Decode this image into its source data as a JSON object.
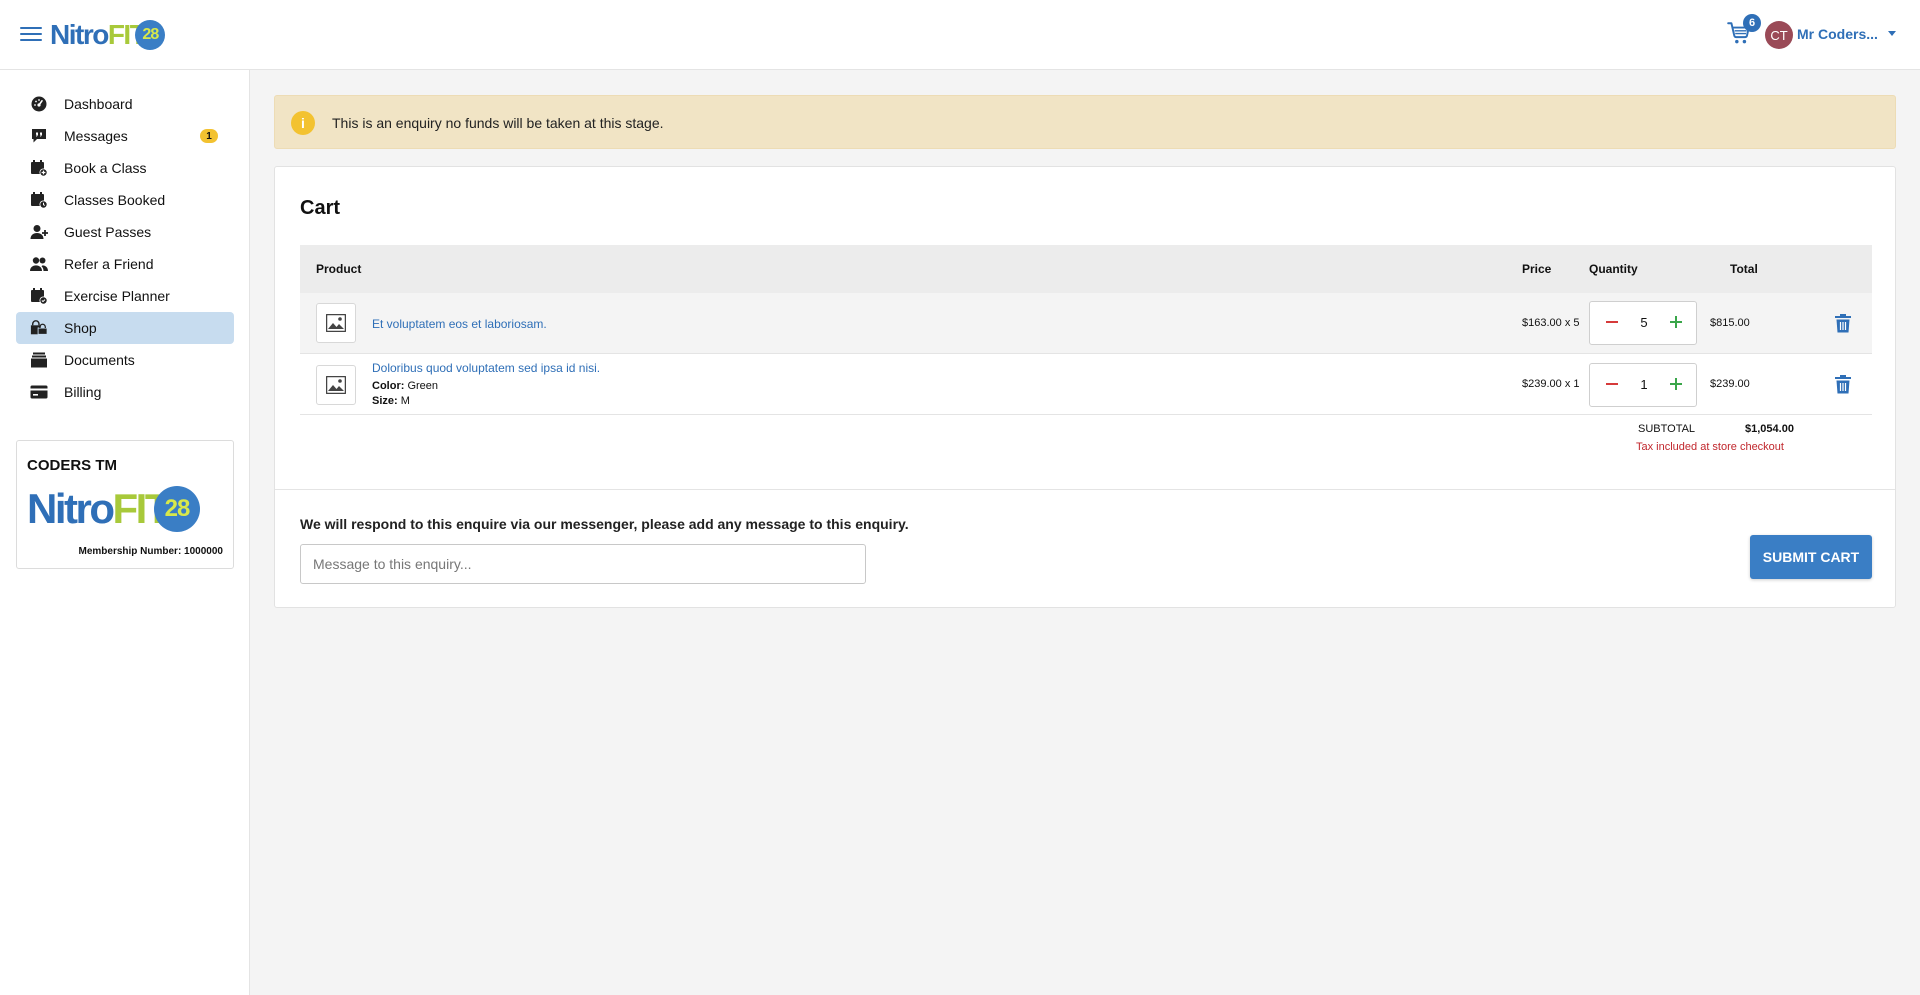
{
  "header": {
    "logo_nitro": "Nitro",
    "logo_fit": "FIT",
    "logo_num": "28",
    "cart_count": "6",
    "avatar_initials": "CT",
    "user_name": "Mr Coders..."
  },
  "sidebar": {
    "items": [
      {
        "label": "Dashboard",
        "icon": "gauge-icon"
      },
      {
        "label": "Messages",
        "icon": "quote-message-icon",
        "badge": "1"
      },
      {
        "label": "Book a Class",
        "icon": "calendar-plus-icon"
      },
      {
        "label": "Classes Booked",
        "icon": "calendar-clock-icon"
      },
      {
        "label": "Guest Passes",
        "icon": "user-add-icon"
      },
      {
        "label": "Refer a Friend",
        "icon": "users-icon"
      },
      {
        "label": "Exercise Planner",
        "icon": "calendar-check-icon"
      },
      {
        "label": "Shop",
        "icon": "shop-icon",
        "active": true
      },
      {
        "label": "Documents",
        "icon": "documents-icon"
      },
      {
        "label": "Billing",
        "icon": "credit-card-icon"
      }
    ],
    "member": {
      "name": "CODERS TM",
      "number_label": "Membership Number: 1000000"
    }
  },
  "alert": {
    "text": "This is an enquiry no funds will be taken at this stage.",
    "icon": "info-icon"
  },
  "cart": {
    "title": "Cart",
    "columns": {
      "product": "Product",
      "price": "Price",
      "quantity": "Quantity",
      "total": "Total"
    },
    "rows": [
      {
        "name": "Et voluptatem eos et laboriosam.",
        "price": "$163.00 x 5",
        "qty": "5",
        "total": "$815.00"
      },
      {
        "name": "Doloribus quod voluptatem sed ipsa id nisi.",
        "color_label": "Color:",
        "color": "Green",
        "size_label": "Size:",
        "size": "M",
        "price": "$239.00 x 1",
        "qty": "1",
        "total": "$239.00"
      }
    ],
    "subtotal_label": "SUBTOTAL",
    "subtotal": "$1,054.00",
    "tax_note": "Tax included at store checkout"
  },
  "enquiry": {
    "respond_text": "We will respond to this enquire via our messenger, please add any message to this enquiry.",
    "placeholder": "Message to this enquiry...",
    "submit_label": "SUBMIT CART"
  },
  "colors": {
    "brand_blue": "#2f6fb7",
    "brand_green": "#a8c93a",
    "alert_bg": "#f1e4c5",
    "active_nav": "#c7dcef",
    "danger": "#c1272d"
  }
}
